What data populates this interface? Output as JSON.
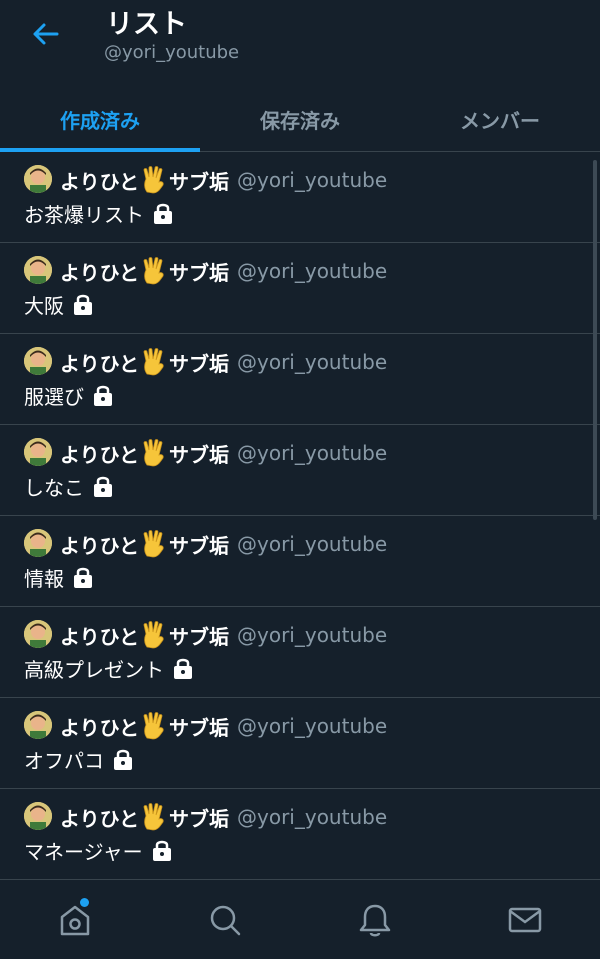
{
  "header": {
    "title": "リスト",
    "handle": "@yori_youtube"
  },
  "tabs": [
    {
      "label": "作成済み",
      "active": true
    },
    {
      "label": "保存済み",
      "active": false
    },
    {
      "label": "メンバー",
      "active": false
    }
  ],
  "owner": {
    "name_prefix": "よりひと",
    "name_suffix": "サブ垢",
    "handle": "@yori_youtube"
  },
  "lists": [
    {
      "name": "お茶爆リスト",
      "private": true
    },
    {
      "name": "大阪",
      "private": true
    },
    {
      "name": "服選び",
      "private": true
    },
    {
      "name": "しなこ",
      "private": true
    },
    {
      "name": "情報",
      "private": true
    },
    {
      "name": "高級プレゼント",
      "private": true
    },
    {
      "name": "オフパコ",
      "private": true
    },
    {
      "name": "マネージャー",
      "private": true
    }
  ],
  "bottom_nav": [
    "home-icon",
    "search-icon",
    "bell-icon",
    "mail-icon"
  ],
  "colors": {
    "background": "#15202b",
    "accent": "#1da1f2",
    "secondary_text": "#8899a6",
    "divider": "#38444d"
  }
}
